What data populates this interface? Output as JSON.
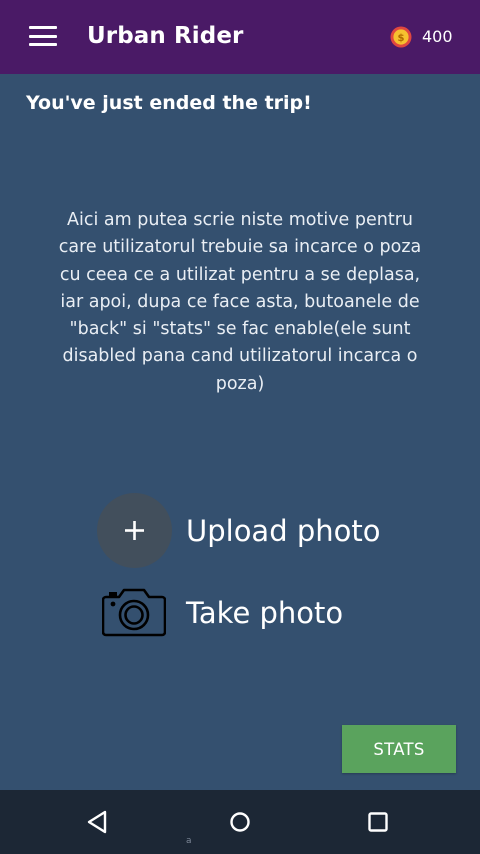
{
  "app": {
    "title": "Urban Rider",
    "coins": "400",
    "accent_color": "#4a1a66",
    "background_color": "#34506f"
  },
  "header": {
    "menu_icon": "hamburger-menu-icon",
    "coin_icon": "coin-icon"
  },
  "main": {
    "heading": "You've just ended the trip!",
    "description": "Aici am putea scrie niste motive pentru care utilizatorul trebuie sa incarce o poza cu ceea ce a utilizat pentru a se deplasa, iar apoi, dupa ce face asta, butoanele de \"back\" si \"stats\" se fac enable(ele sunt disabled pana cand utilizatorul incarca o poza)",
    "upload_label": "Upload photo",
    "take_label": "Take photo",
    "stats_label": "STATS",
    "stats_color": "#5aa35d"
  },
  "navbar": {
    "back_icon": "back-triangle-icon",
    "home_icon": "home-circle-icon",
    "recent_icon": "recent-apps-icon",
    "hint": "a"
  }
}
